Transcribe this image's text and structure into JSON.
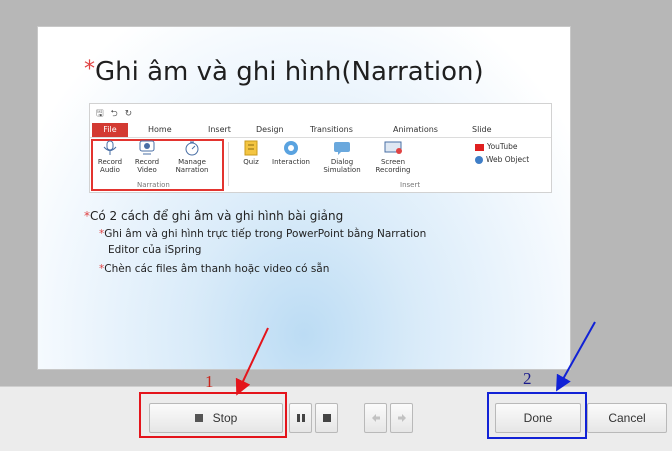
{
  "slide": {
    "title": "Ghi âm và ghi hình(Narration)",
    "ribbon": {
      "quick_access": "🖫 ⮌ ↻",
      "tabs": [
        "File",
        "Home",
        "Insert",
        "Design",
        "Transitions",
        "Animations",
        "Slide"
      ],
      "narration_buttons": [
        {
          "label": "Record\nAudio",
          "icon": "microphone-icon"
        },
        {
          "label": "Record\nVideo",
          "icon": "webcam-icon"
        },
        {
          "label": "Manage\nNarration",
          "icon": "stopwatch-icon"
        }
      ],
      "narration_group_label": "Narration",
      "insert_buttons": [
        {
          "label": "Quiz",
          "icon": "quiz-icon"
        },
        {
          "label": "Interaction",
          "icon": "interaction-icon"
        },
        {
          "label": "Dialog\nSimulation",
          "icon": "dialog-icon"
        },
        {
          "label": "Screen\nRecording",
          "icon": "screen-recording-icon"
        }
      ],
      "insert_small_items": [
        "YouTube",
        "Web Object"
      ],
      "insert_group_label": "Insert"
    },
    "bullet_main": "Có 2 cách để ghi âm và ghi hình bài giảng",
    "bullet_sub_1_line1": "Ghi âm và ghi hình trực tiếp trong PowerPoint bằng Narration",
    "bullet_sub_1_line2": "Editor của iSpring",
    "bullet_sub_2": "Chèn các files âm thanh hoặc video có sẵn"
  },
  "toolbar": {
    "stop_label": "Stop",
    "done_label": "Done",
    "cancel_label": "Cancel"
  },
  "annotations": {
    "marker_1": "1",
    "marker_2": "2",
    "red": "#e4141b",
    "blue": "#1122d6"
  }
}
